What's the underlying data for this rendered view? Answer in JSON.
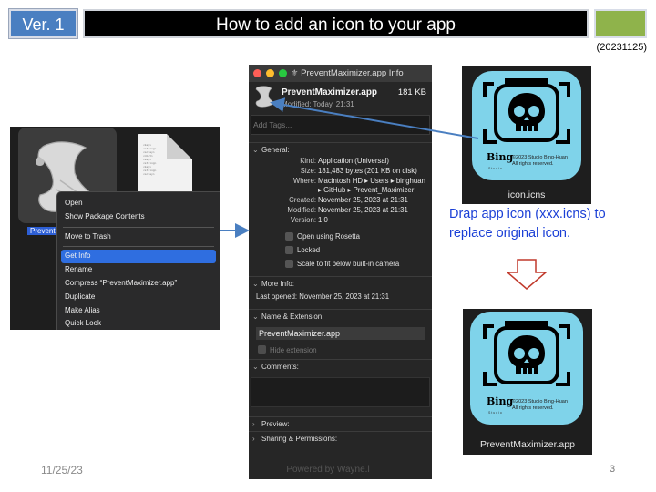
{
  "header": {
    "version_label": "Ver. 1",
    "title": "How to add an icon to your app",
    "date_code": "(20231125)"
  },
  "finder": {
    "app_label": "Prevent",
    "doc_lines": "<key>\n<string>\n<array>\n<dict>\n<key>\n<string>\n<key>\n<string>\n<array>",
    "menu": [
      {
        "label": "Open",
        "selected": false
      },
      {
        "label": "Show Package Contents",
        "selected": false
      },
      {
        "sep": true
      },
      {
        "label": "Move to Trash",
        "selected": false
      },
      {
        "sep": true
      },
      {
        "label": "Get Info",
        "selected": true
      },
      {
        "label": "Rename",
        "selected": false
      },
      {
        "label": "Compress “PreventMaximizer.app”",
        "selected": false
      },
      {
        "label": "Duplicate",
        "selected": false
      },
      {
        "label": "Make Alias",
        "selected": false
      },
      {
        "label": "Quick Look",
        "selected": false
      }
    ]
  },
  "info": {
    "window_title": "PreventMaximizer.app Info",
    "app_name": "PreventMaximizer.app",
    "size": "181 KB",
    "modified": "Modified: Today, 21:31",
    "tags_placeholder": "Add Tags...",
    "general": {
      "heading": "General:",
      "rows": [
        {
          "k": "Kind:",
          "v": "Application (Universal)"
        },
        {
          "k": "Size:",
          "v": "181,483 bytes (201 KB on disk)"
        },
        {
          "k": "Where:",
          "v": "Macintosh HD ▸ Users ▸ binghuan"
        },
        {
          "k": "",
          "v": "▸ GitHub ▸ Prevent_Maximizer"
        },
        {
          "k": "Created:",
          "v": "November 25, 2023 at 21:31"
        },
        {
          "k": "Modified:",
          "v": "November 25, 2023 at 21:31"
        },
        {
          "k": "Version:",
          "v": "1.0"
        }
      ],
      "checks": [
        "Open using Rosetta",
        "Locked",
        "Scale to fit below built-in camera"
      ]
    },
    "more_info": {
      "heading": "More Info:",
      "last_opened": "Last opened: November 25, 2023 at 21:31"
    },
    "name_ext": {
      "heading": "Name & Extension:",
      "value": "PreventMaximizer.app",
      "hide_ext": "Hide extension"
    },
    "comments": {
      "heading": "Comments:"
    },
    "preview": {
      "heading": "Preview:"
    },
    "sharing": {
      "heading": "Sharing & Permissions:"
    }
  },
  "icon_top": {
    "caption": "icon.icns",
    "bing": "Bing",
    "copyright": "©2023 Studio Bing-Huan",
    "rights": "All rights reserved.",
    "studio": "S t u d i o"
  },
  "instruction": {
    "line1": "Drap app icon (xxx.icns) to",
    "line2": "replace original icon."
  },
  "icon_bottom": {
    "caption": "PreventMaximizer.app",
    "bing": "Bing",
    "copyright": "©2023 Studio Bing-Huan",
    "rights": "All rights reserved.",
    "studio": "S t u d i o"
  },
  "footer": {
    "date": "11/25/23",
    "center": "Powered by Wayne.l",
    "page": "3"
  },
  "colors": {
    "version_bg": "#4a7fc1",
    "green_box": "#8fb34b",
    "instruction": "#1a3fd6",
    "selection": "#2f6ee0",
    "icon_bg": "#7fd3ea",
    "down_arrow": "#c0392b"
  }
}
